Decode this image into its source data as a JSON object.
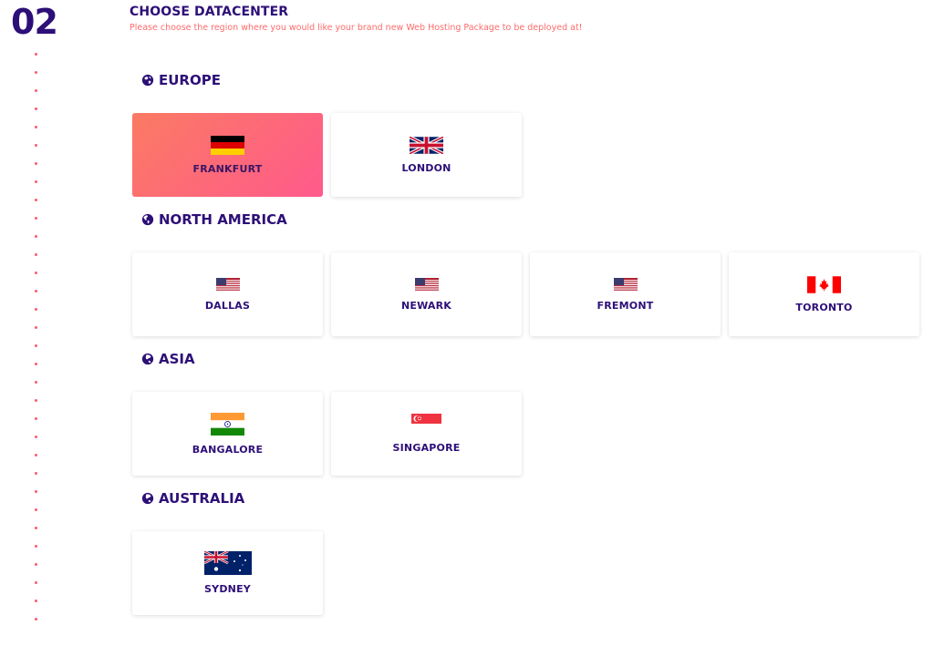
{
  "step": {
    "number": "02"
  },
  "header": {
    "title": "CHOOSE DATACENTER",
    "subtitle": "Please choose the region where you would like your brand new Web Hosting Package to be deployed at!"
  },
  "regions": [
    {
      "name": "EUROPE",
      "icon": "globe-europe-icon",
      "locations": [
        {
          "label": "FRANKFURT",
          "flag": "germany-flag-icon",
          "selected": true
        },
        {
          "label": "LONDON",
          "flag": "uk-flag-icon",
          "selected": false
        }
      ]
    },
    {
      "name": "NORTH AMERICA",
      "icon": "globe-americas-icon",
      "locations": [
        {
          "label": "DALLAS",
          "flag": "usa-flag-icon",
          "selected": false
        },
        {
          "label": "NEWARK",
          "flag": "usa-flag-icon",
          "selected": false
        },
        {
          "label": "FREMONT",
          "flag": "usa-flag-icon",
          "selected": false
        },
        {
          "label": "TORONTO",
          "flag": "canada-flag-icon",
          "selected": false
        }
      ]
    },
    {
      "name": "ASIA",
      "icon": "globe-asia-icon",
      "locations": [
        {
          "label": "BANGALORE",
          "flag": "india-flag-icon",
          "selected": false
        },
        {
          "label": "SINGAPORE",
          "flag": "singapore-flag-icon",
          "selected": false
        }
      ]
    },
    {
      "name": "AUSTRALIA",
      "icon": "globe-asia-icon",
      "locations": [
        {
          "label": "SYDNEY",
          "flag": "australia-flag-icon",
          "selected": false
        }
      ]
    }
  ],
  "colors": {
    "heading": "#2d0f78",
    "accent": "#ff6b6b",
    "selected_gradient_start": "#fb7a63",
    "selected_gradient_end": "#ff5a8c"
  }
}
